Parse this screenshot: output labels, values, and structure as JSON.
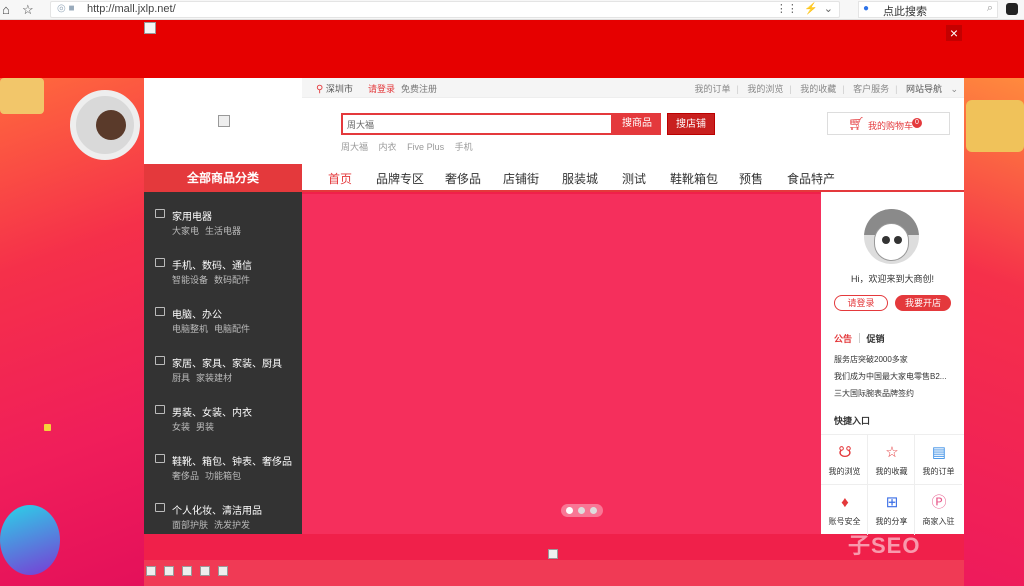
{
  "browser": {
    "url": "http://mall.jxlp.net/",
    "search_engine_label": "点此搜索",
    "back_glyph": "⌂",
    "star_glyph": "☆"
  },
  "topbar": {
    "location": "深圳市",
    "login": "请登录",
    "register": "免费注册",
    "links": [
      "我的订单",
      "我的浏览",
      "我的收藏",
      "客户服务",
      "网站导航"
    ]
  },
  "search": {
    "value": "周大福",
    "btn_goods": "搜商品",
    "btn_shop": "搜店铺",
    "hot_words": [
      "周大福",
      "内衣",
      "Five Plus",
      "手机"
    ]
  },
  "cart": {
    "label": "我的购物车",
    "count": "0"
  },
  "all_categories_label": "全部商品分类",
  "nav": [
    "首页",
    "品牌专区",
    "奢侈品",
    "店铺街",
    "服装城",
    "测试",
    "鞋靴箱包",
    "预售",
    "食品特产"
  ],
  "categories": [
    {
      "title": "家用电器",
      "subs": [
        "大家电",
        "生活电器"
      ]
    },
    {
      "title": "手机、数码、通信",
      "subs": [
        "智能设备",
        "数码配件"
      ]
    },
    {
      "title": "电脑、办公",
      "subs": [
        "电脑整机",
        "电脑配件"
      ]
    },
    {
      "title": "家居、家具、家装、厨具",
      "subs": [
        "厨具",
        "家装建材"
      ]
    },
    {
      "title": "男装、女装、内衣",
      "subs": [
        "女装",
        "男装"
      ]
    },
    {
      "title": "鞋靴、箱包、钟表、奢侈品",
      "subs": [
        "奢侈品",
        "功能箱包"
      ]
    },
    {
      "title": "个人化妆、清洁用品",
      "subs": [
        "面部护肤",
        "洗发护发"
      ]
    }
  ],
  "user_panel": {
    "welcome": "Hi，欢迎来到大商创!",
    "login_btn": "请登录",
    "open_shop_btn": "我要开店",
    "tab_notice": "公告",
    "tab_promo": "促销",
    "news": [
      "服务店突破2000多家",
      "我们成为中国最大家电零售B2...",
      "三大国际腕表品牌签约"
    ],
    "quick_title": "快捷入口",
    "quick_links": [
      {
        "label": "我的浏览",
        "icon": "browse-icon",
        "glyph": "☋",
        "color": "#e4393c"
      },
      {
        "label": "我的收藏",
        "icon": "star-icon",
        "glyph": "☆",
        "color": "#e4393c"
      },
      {
        "label": "我的订单",
        "icon": "order-icon",
        "glyph": "▤",
        "color": "#3a8ee6"
      },
      {
        "label": "账号安全",
        "icon": "security-icon",
        "glyph": "♦",
        "color": "#e4393c"
      },
      {
        "label": "我的分享",
        "icon": "share-icon",
        "glyph": "⊞",
        "color": "#3a6ee6"
      },
      {
        "label": "商家入驻",
        "icon": "merchant-icon",
        "glyph": "Ⓟ",
        "color": "#e85a8c"
      }
    ]
  },
  "watermark": "子SEO",
  "ad_close": "×",
  "colors": {
    "accent": "#e4393c",
    "dark_panel": "#333333"
  }
}
